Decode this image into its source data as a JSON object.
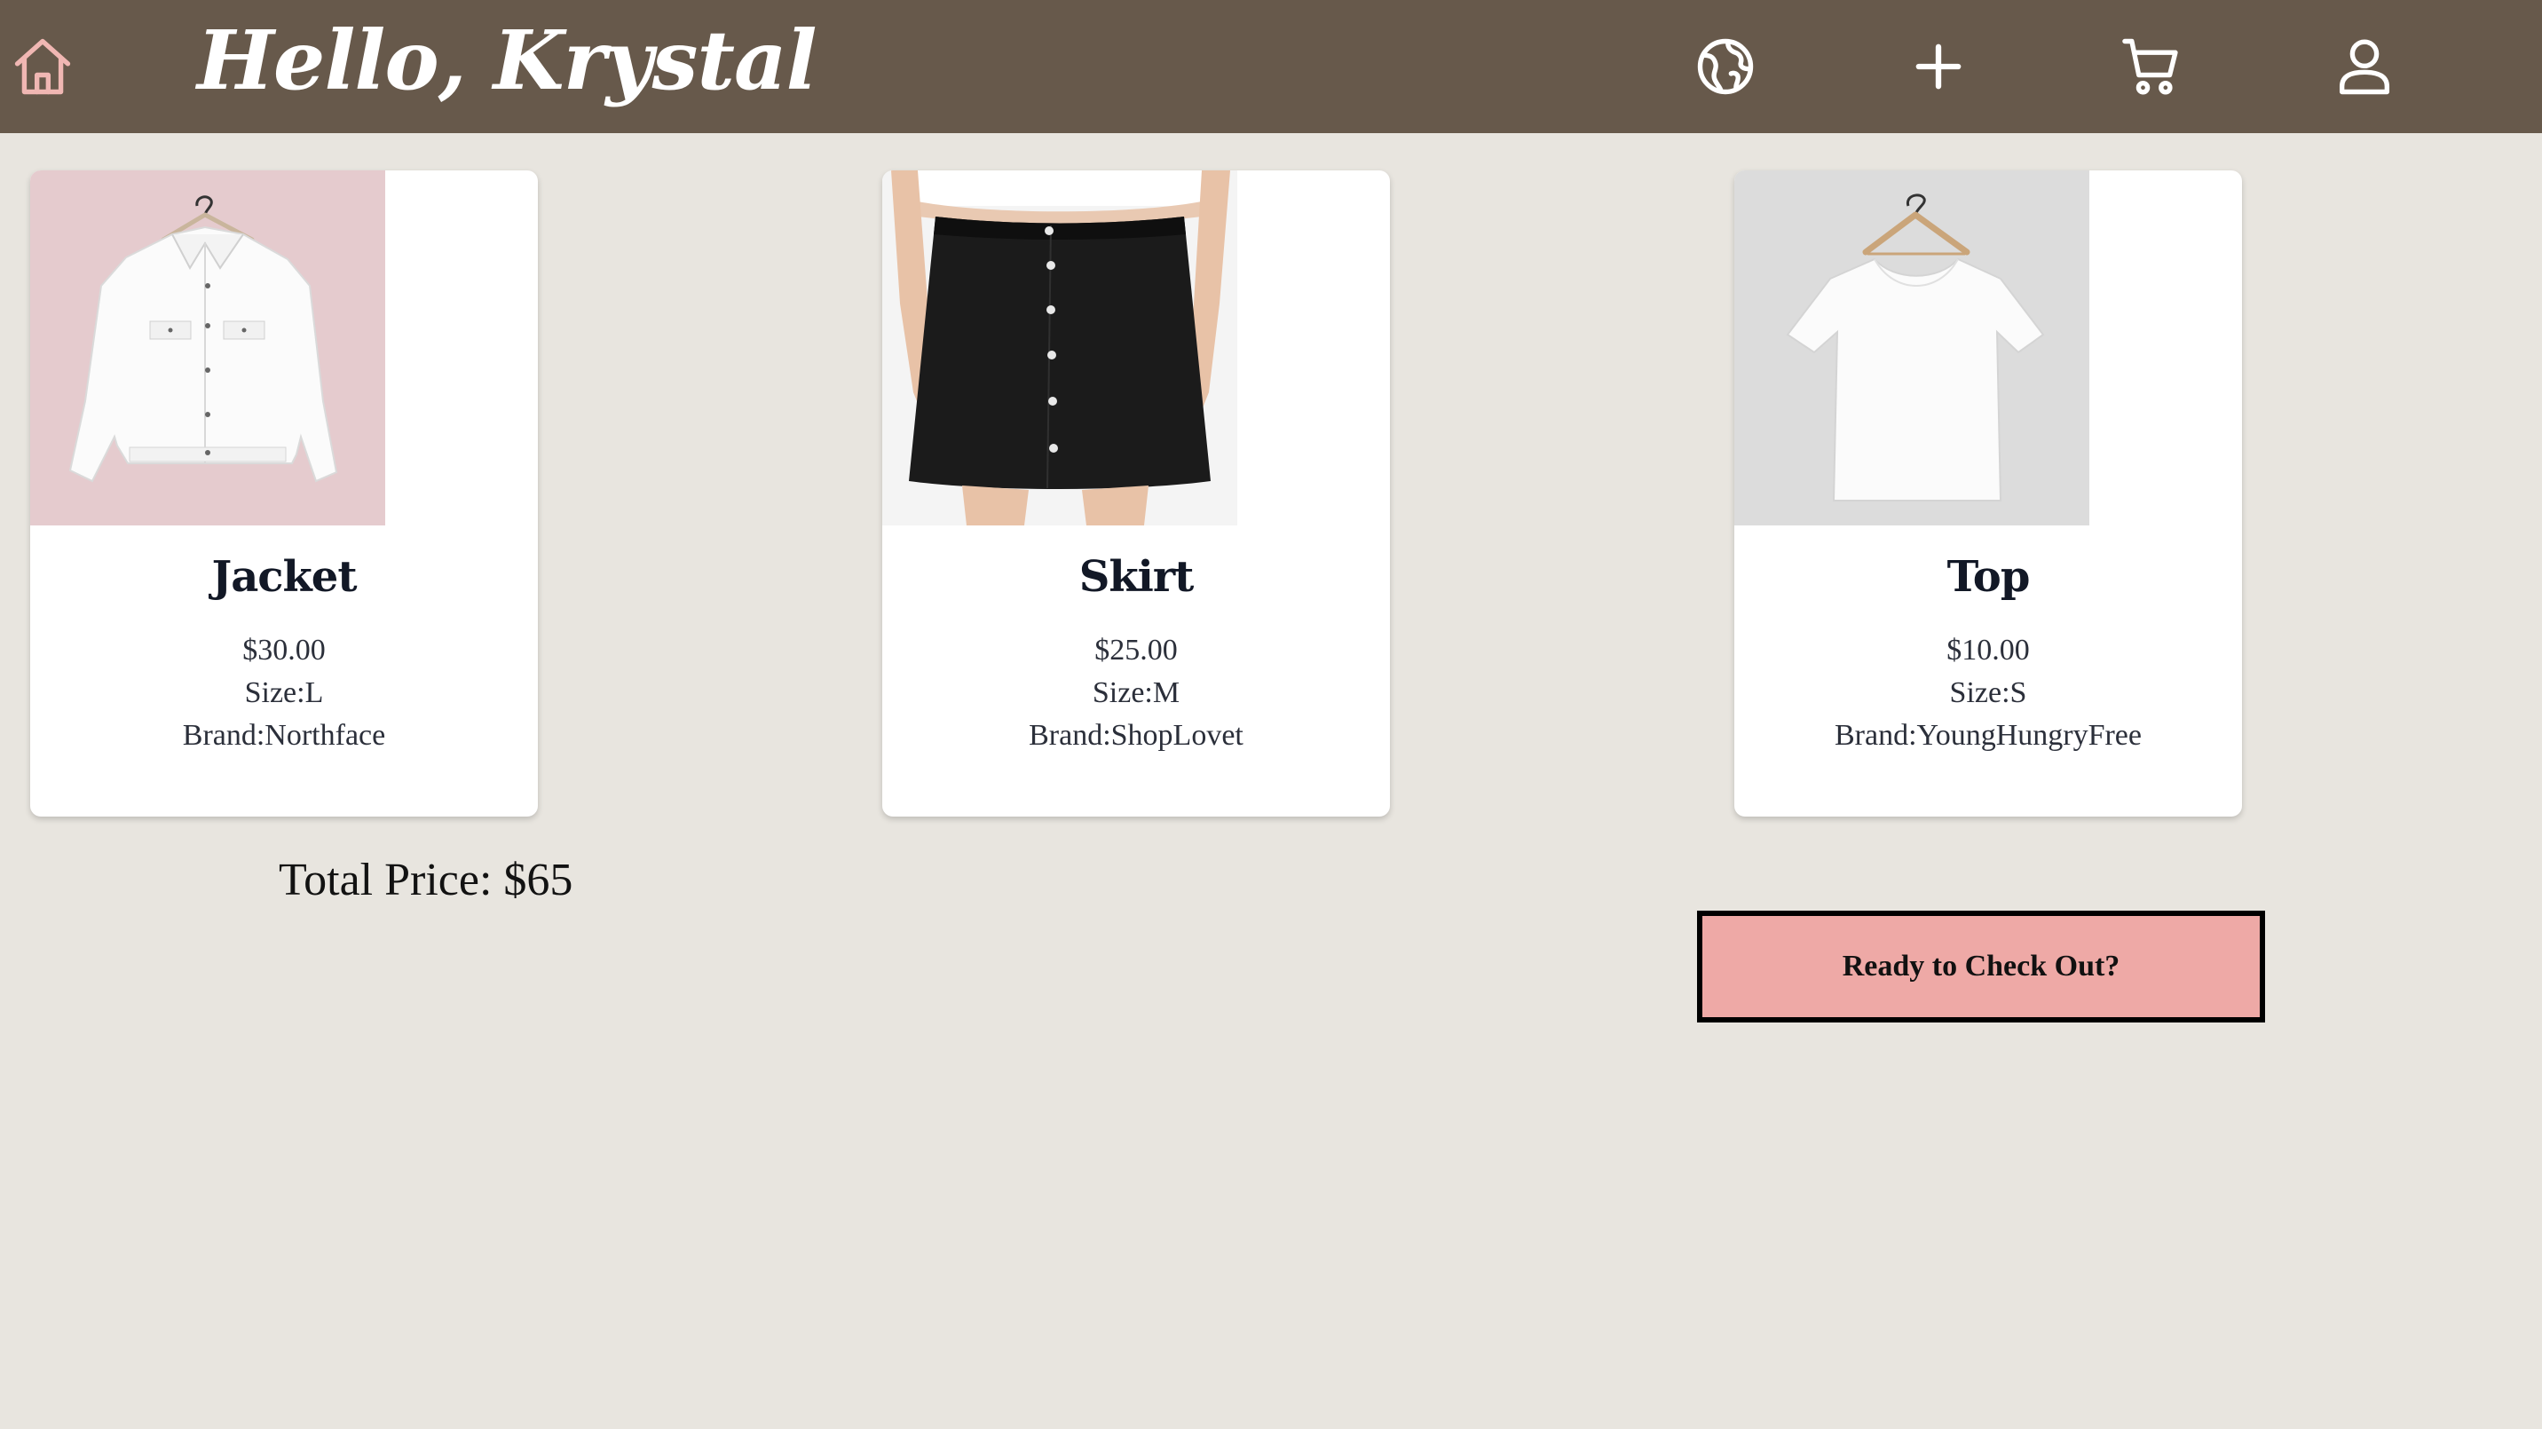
{
  "header": {
    "greeting": "Hello, Krystal",
    "icons": [
      "home-icon",
      "globe-icon",
      "plus-icon",
      "cart-icon",
      "user-icon"
    ]
  },
  "cart": {
    "items": [
      {
        "name": "Jacket",
        "price": "$30.00",
        "size": "Size:L",
        "brand": "Brand:Northface",
        "image": "white-denim-jacket"
      },
      {
        "name": "Skirt",
        "price": "$25.00",
        "size": "Size:M",
        "brand": "Brand:ShopLovet",
        "image": "black-button-skirt"
      },
      {
        "name": "Top",
        "price": "$10.00",
        "size": "Size:S",
        "brand": "Brand:YoungHungryFree",
        "image": "white-tshirt"
      }
    ],
    "total_label": "Total Price: $65",
    "checkout_label": "Ready to Check Out?"
  },
  "colors": {
    "navbar": "#67594b",
    "background": "#e8e5df",
    "home_icon": "#f0b7b3",
    "checkout_button": "#eea9a6"
  }
}
